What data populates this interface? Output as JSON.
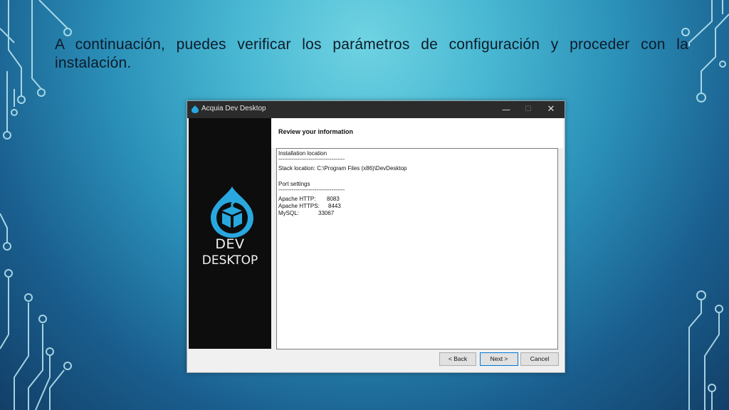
{
  "slide": {
    "text": "A continuación, puedes verificar los parámetros de configuración y proceder con la instalación."
  },
  "window": {
    "title": "Acquia Dev Desktop",
    "controls": {
      "minimize": "—",
      "maximize": "☐",
      "close": "✕"
    }
  },
  "logo": {
    "line1": "DEV",
    "line2": "DESKTOP"
  },
  "header": {
    "title": "Review your information"
  },
  "info": {
    "installation_heading": "Installation location",
    "separator": "-----------------------------------",
    "stack_location": "Stack location: C:\\Program Files (x86)\\DevDesktop",
    "port_heading": "Port settings",
    "ports": [
      {
        "label": "Apache HTTP:",
        "value": "8083"
      },
      {
        "label": "Apache HTTPS:",
        "value": "8443"
      },
      {
        "label": "MySQL:",
        "value": "33067"
      }
    ]
  },
  "buttons": {
    "back": "< Back",
    "next": "Next >",
    "cancel": "Cancel"
  },
  "colors": {
    "drupal_blue": "#29a8e0",
    "titlebar": "#2b2b2b",
    "sidebar": "#0d0d0d",
    "focus_border": "#0078d7"
  }
}
